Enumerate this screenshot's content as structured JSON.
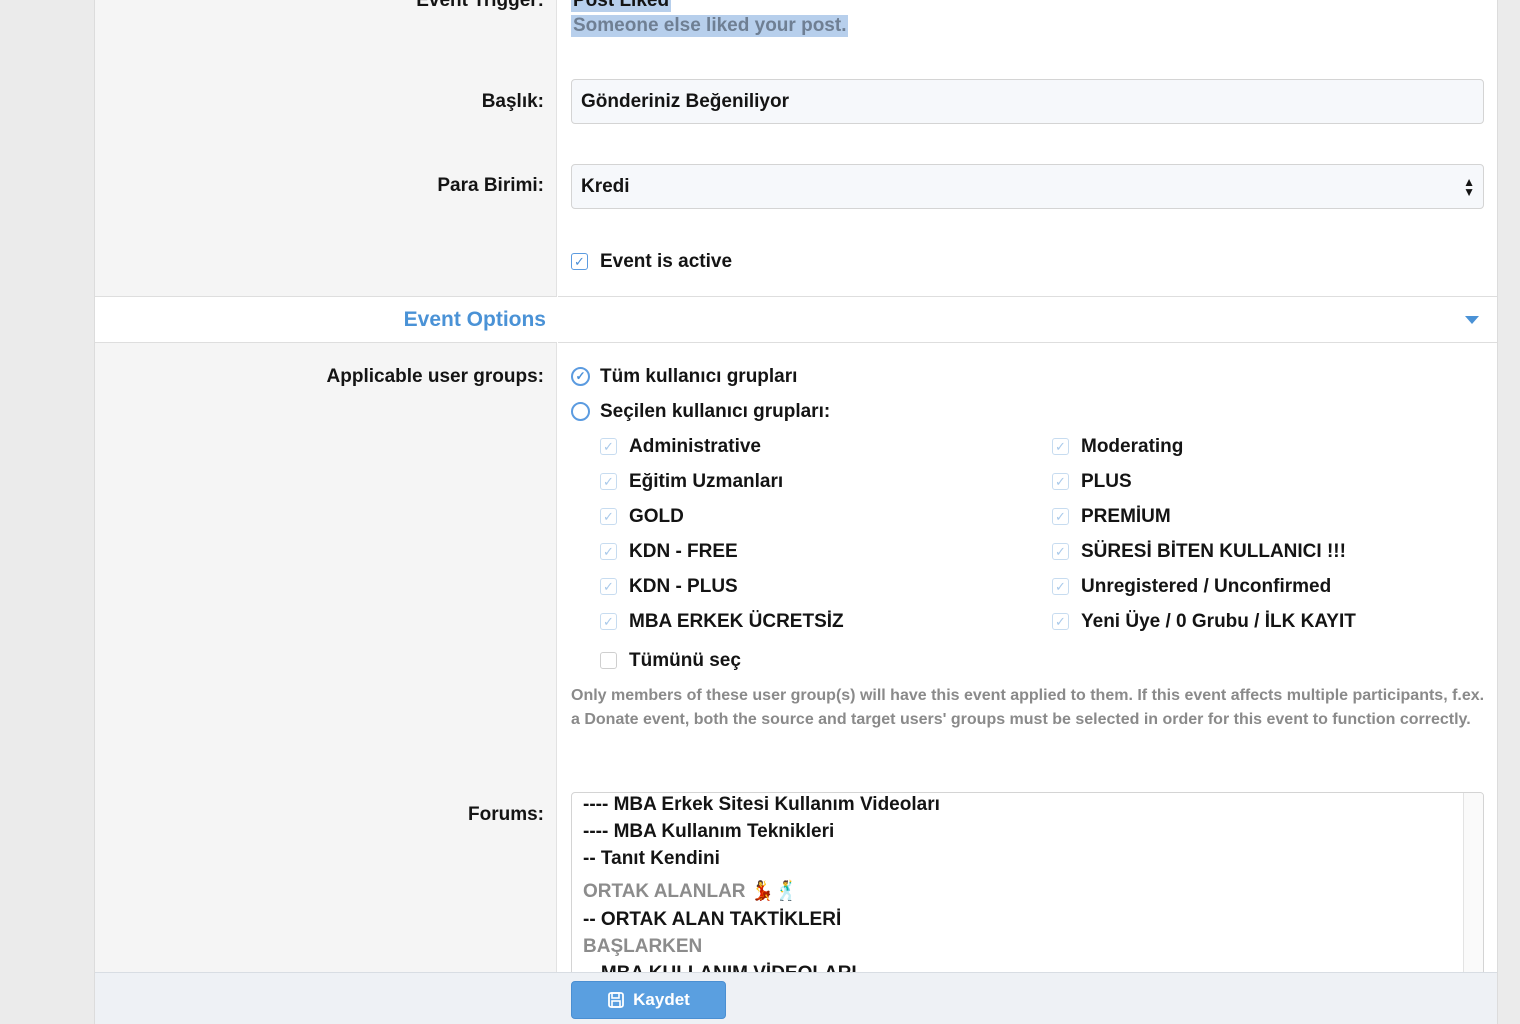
{
  "event_trigger": {
    "label": "Event Trigger:",
    "title": "Post Liked",
    "description": "Someone else liked your post."
  },
  "baslik": {
    "label": "Başlık:",
    "value": "Gönderiniz Beğeniliyor"
  },
  "para_birimi": {
    "label": "Para Birimi:",
    "value": "Kredi"
  },
  "event_active": {
    "label": "Event is active",
    "checked": true
  },
  "event_options": {
    "title": "Event Options"
  },
  "user_groups": {
    "label": "Applicable user groups:",
    "all_label": "Tüm kullanıcı grupları",
    "selected_label": "Seçilen kullanıcı grupları:",
    "left": [
      "Administrative",
      "Eğitim Uzmanları",
      "GOLD",
      "KDN - FREE",
      "KDN - PLUS",
      "MBA ERKEK ÜCRETSİZ"
    ],
    "right": [
      "Moderating",
      "PLUS",
      "PREMİUM",
      "SÜRESİ BİTEN KULLANICI !!!",
      "Unregistered / Unconfirmed",
      "Yeni Üye / 0 Grubu / İLK KAYIT"
    ],
    "select_all": "Tümünü seç",
    "help": "Only members of these user group(s) will have this event applied to them. If this event affects multiple participants, f.ex. a Donate event, both the source and target users' groups must be selected in order for this event to function correctly."
  },
  "forums": {
    "label": "Forums:",
    "items": [
      "---- MBA Erkek Sitesi Kullanım Videoları",
      "---- MBA Kullanım Teknikleri",
      "-- Tanıt Kendini",
      "ORTAK ALANLAR 💃🕺",
      "-- ORTAK ALAN TAKTİKLERİ",
      "BAŞLARKEN",
      "-- MBA KULLANIM VİDEOLARI"
    ]
  },
  "footer": {
    "save_label": "Kaydet"
  },
  "colors": {
    "accent": "#4a92d6",
    "button": "#5a9fe0",
    "highlight": "#b7cfec"
  }
}
